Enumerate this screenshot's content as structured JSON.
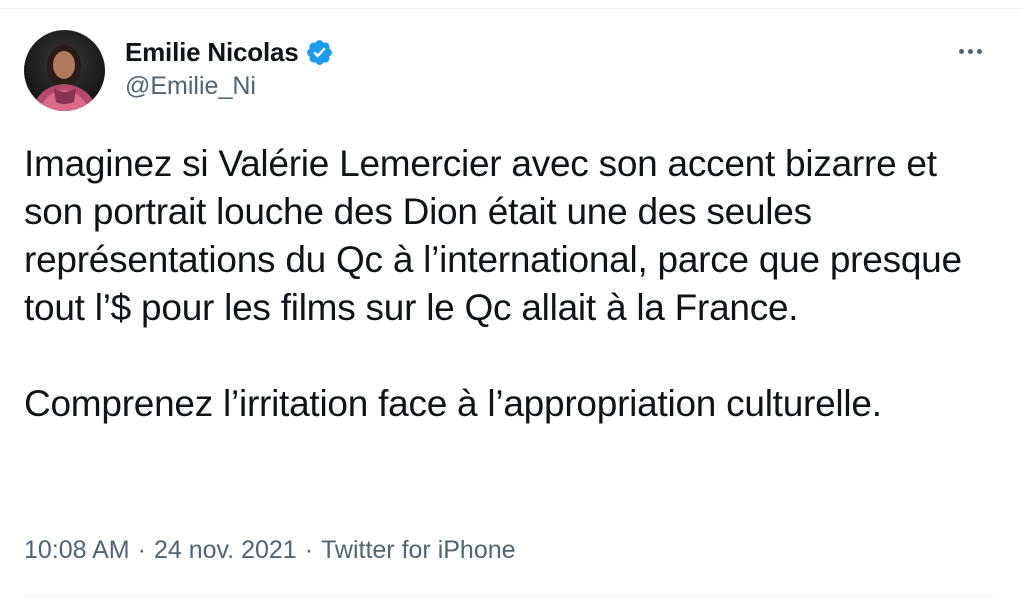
{
  "author": {
    "display_name": "Emilie Nicolas",
    "handle": "@Emilie_Ni",
    "verified": true
  },
  "tweet": {
    "paragraphs": [
      "Imaginez si Valérie Lemercier avec son accent bizarre et son portrait louche des Dion était une des seules représentations du Qc à l’international, parce que presque tout l’$ pour les films sur le Qc allait à la France.",
      "Comprenez l’irritation face à l’appropriation culturelle."
    ]
  },
  "meta": {
    "time": "10:08 AM",
    "date": "24 nov. 2021",
    "separator": "·",
    "source": "Twitter for iPhone"
  },
  "colors": {
    "text": "#0f1419",
    "muted": "#536471",
    "verified": "#1d9bf0",
    "divider": "#eff3f4"
  },
  "icons": {
    "verified": "verified-badge-icon",
    "more": "more-horizontal-icon"
  }
}
